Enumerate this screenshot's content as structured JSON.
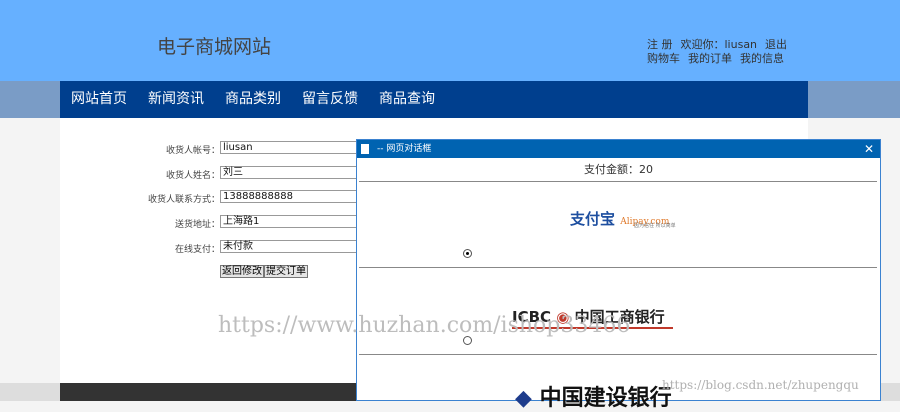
{
  "header": {
    "title": "电子商城网站",
    "links_row1": [
      "注 册",
      "欢迎你：liusan",
      "退出"
    ],
    "links_row2": [
      "购物车",
      "我的订单",
      "我的信息"
    ]
  },
  "nav": [
    "网站首页",
    "新闻资讯",
    "商品类别",
    "留言反馈",
    "商品查询"
  ],
  "form": {
    "fields": [
      {
        "label": "收货人帐号：",
        "value": "liusan"
      },
      {
        "label": "收货人姓名：",
        "value": "刘三"
      },
      {
        "label": "收货人联系方式：",
        "value": "13888888888"
      },
      {
        "label": "送货地址：",
        "value": "上海路1"
      },
      {
        "label": "在线支付：",
        "value": "未付款"
      }
    ],
    "back_button": "返回修改",
    "submit_button": "提交订单"
  },
  "dialog": {
    "title": "-- 网页对话框",
    "amount": "支付金额：20",
    "options": [
      {
        "name": "支付宝",
        "sub": "Alipay.com",
        "tagline": "因为信任 所以简单",
        "selected": true
      },
      {
        "name": "中国工商银行",
        "sub": "ICBC",
        "selected": false
      },
      {
        "name": "中国建设银行",
        "selected": false
      }
    ]
  },
  "watermarks": [
    "https://www.huzhan.com/ishop33466",
    "https://blog.csdn.net/zhupengqu"
  ]
}
